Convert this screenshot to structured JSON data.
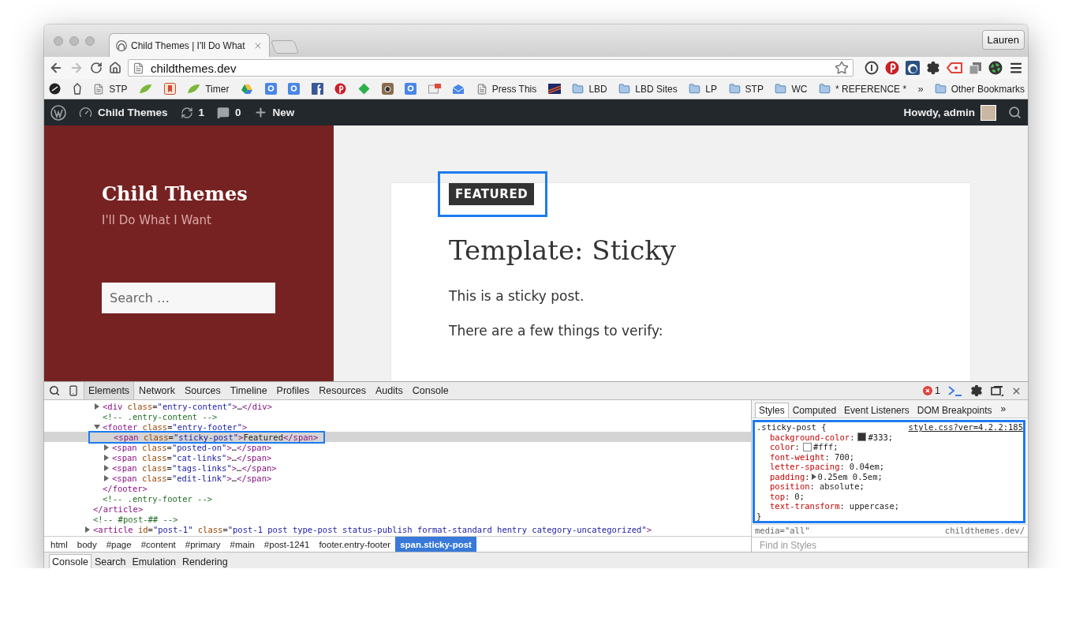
{
  "browser": {
    "tab_title": "Child Themes | I'll Do What",
    "profile": "Lauren",
    "url": "childthemes.dev",
    "bookmarks": [
      {
        "kind": "dark-circle"
      },
      {
        "kind": "creature"
      },
      {
        "kind": "page",
        "label": "STP"
      },
      {
        "kind": "leaf"
      },
      {
        "kind": "bookmark"
      },
      {
        "kind": "leaf",
        "label": "Timer"
      },
      {
        "kind": "drive"
      },
      {
        "kind": "google"
      },
      {
        "kind": "google"
      },
      {
        "kind": "facebook"
      },
      {
        "kind": "pinterest"
      },
      {
        "kind": "feedly"
      },
      {
        "kind": "camera"
      },
      {
        "kind": "google"
      },
      {
        "kind": "news"
      },
      {
        "kind": "mail"
      },
      {
        "kind": "page",
        "label": "Press This"
      },
      {
        "kind": "flag"
      },
      {
        "kind": "folder",
        "label": "LBD"
      },
      {
        "kind": "folder",
        "label": "LBD Sites"
      },
      {
        "kind": "folder",
        "label": "LP"
      },
      {
        "kind": "folder",
        "label": "STP"
      },
      {
        "kind": "folder",
        "label": "WC"
      },
      {
        "kind": "folder",
        "label": "* REFERENCE *"
      }
    ],
    "bookmarks_overflow": "»",
    "other_bookmarks": "Other Bookmarks"
  },
  "admin_bar": {
    "items": [
      {
        "kind": "wordpress"
      },
      {
        "kind": "dashboard",
        "label": "Child Themes"
      },
      {
        "kind": "updates",
        "label": "1"
      },
      {
        "kind": "comments",
        "label": "0"
      },
      {
        "kind": "new",
        "label": "New"
      }
    ],
    "greeting": "Howdy, admin"
  },
  "site": {
    "title": "Child Themes",
    "tagline": "I'll Do What I Want",
    "search_placeholder": "Search …"
  },
  "post": {
    "badge": "FEATURED",
    "title": "Template: Sticky",
    "paragraphs": [
      "This is a sticky post.",
      "There are a few things to verify:"
    ]
  },
  "devtools": {
    "tabs": [
      {
        "label": "Elements",
        "selected": true
      },
      {
        "label": "Network",
        "selected": false
      },
      {
        "label": "Sources",
        "selected": false
      },
      {
        "label": "Timeline",
        "selected": false
      },
      {
        "label": "Profiles",
        "selected": false
      },
      {
        "label": "Resources",
        "selected": false
      },
      {
        "label": "Audits",
        "selected": false
      },
      {
        "label": "Console",
        "selected": false
      }
    ],
    "error_count": "1",
    "dom_tree": [
      {
        "kind": "element",
        "selected": false,
        "children": [
          {
            "kind": "element",
            "text": "<div class=\"entry-content\">…</div>",
            "expanded": false,
            "selected": false
          },
          {
            "kind": "comment",
            "text": "<!-- .entry-content -->",
            "selected": false
          },
          {
            "kind": "element",
            "text": "<footer class=\"entry-footer\">",
            "expanded": true,
            "selected": false,
            "close": "</footer>",
            "children": [
              {
                "kind": "element",
                "text": "<span class=\"sticky-post\">Featured</span>",
                "selected": true,
                "annotated": true
              },
              {
                "kind": "element",
                "text": "<span class=\"posted-on\">…</span>",
                "expanded": false,
                "selected": false
              },
              {
                "kind": "element",
                "text": "<span class=\"cat-links\">…</span>",
                "expanded": false,
                "selected": false
              },
              {
                "kind": "element",
                "text": "<span class=\"tags-links\">…</span>",
                "expanded": false,
                "selected": false
              },
              {
                "kind": "element",
                "text": "<span class=\"edit-link\">…</span>",
                "expanded": false,
                "selected": false
              }
            ]
          },
          {
            "kind": "comment",
            "text": "<!-- .entry-footer -->",
            "selected": false
          }
        ],
        "close": "</article>"
      },
      {
        "kind": "comment",
        "text": "<!-- #post-## -->",
        "selected": false
      },
      {
        "kind": "element",
        "text": "<article id=\"post-1\" class=\"post-1 post type-post status-publish format-standard hentry category-uncategorized\">",
        "expanded": false,
        "selected": false
      }
    ],
    "breadcrumbs": [
      {
        "label": "html",
        "selected": false
      },
      {
        "label": "body",
        "selected": false
      },
      {
        "label": "#page",
        "selected": false
      },
      {
        "label": "#content",
        "selected": false
      },
      {
        "label": "#primary",
        "selected": false
      },
      {
        "label": "#main",
        "selected": false
      },
      {
        "label": "#post-1241",
        "selected": false
      },
      {
        "label": "footer.entry-footer",
        "selected": false
      },
      {
        "label": "span.sticky-post",
        "selected": true
      }
    ],
    "sidebar_tabs": [
      {
        "label": "Styles",
        "selected": true
      },
      {
        "label": "Computed",
        "selected": false
      },
      {
        "label": "Event Listeners",
        "selected": false
      },
      {
        "label": "DOM Breakpoints",
        "selected": false
      }
    ],
    "sidebar_more": "»",
    "rule": {
      "selector": ".sticky-post {",
      "separator": ":",
      "source": "style.css?ver=4.2.2:185",
      "declarations": [
        {
          "name": "background-color",
          "value": "#333;",
          "color": "#333333"
        },
        {
          "name": "color",
          "value": "#fff;",
          "color": "#ffffff"
        },
        {
          "name": "font-weight",
          "value": "700;"
        },
        {
          "name": "letter-spacing",
          "value": "0.04em;"
        },
        {
          "name": "padding",
          "value": "0.25em 0.5em;",
          "expanded": false
        },
        {
          "name": "position",
          "value": "absolute;"
        },
        {
          "name": "top",
          "value": "0;"
        },
        {
          "name": "text-transform",
          "value": "uppercase;"
        }
      ],
      "close": "}"
    },
    "media": "media=\"all\"",
    "media_source": "childthemes.dev/",
    "filter_placeholder": "Find in Styles",
    "drawer_tabs": [
      {
        "label": "Console",
        "selected": true
      },
      {
        "label": "Search",
        "selected": false
      },
      {
        "label": "Emulation",
        "selected": false
      },
      {
        "label": "Rendering",
        "selected": false
      }
    ]
  }
}
